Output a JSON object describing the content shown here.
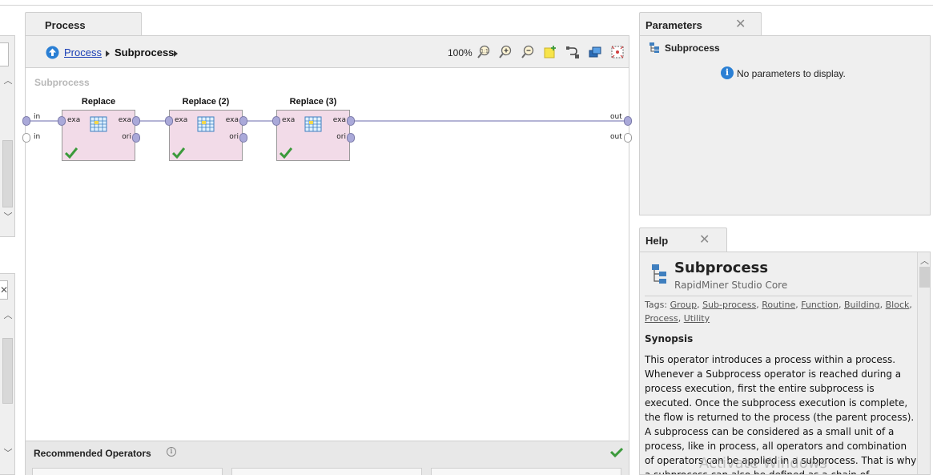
{
  "process_panel": {
    "tab_label": "Process",
    "breadcrumb": {
      "link": "Process",
      "current": "Subprocess"
    },
    "zoom": "100%",
    "canvas_title": "Subprocess",
    "left_ports": [
      "in",
      "in"
    ],
    "right_ports": [
      "out",
      "out"
    ],
    "operators": [
      {
        "name": "Replace",
        "in_label": "exa",
        "out_labels": [
          "exa",
          "ori"
        ]
      },
      {
        "name": "Replace (2)",
        "in_label": "exa",
        "out_labels": [
          "exa",
          "ori"
        ]
      },
      {
        "name": "Replace (3)",
        "in_label": "exa",
        "out_labels": [
          "exa",
          "ori"
        ]
      }
    ],
    "recommended_label": "Recommended Operators"
  },
  "parameters_panel": {
    "tab_label": "Parameters",
    "operator_name": "Subprocess",
    "message": "No parameters to display."
  },
  "help_panel": {
    "tab_label": "Help",
    "title": "Subprocess",
    "subtitle": "RapidMiner Studio Core",
    "tags_label": "Tags:",
    "tags": [
      "Group",
      "Sub-process",
      "Routine",
      "Function",
      "Building",
      "Block",
      "Process",
      "Utility"
    ],
    "synopsis_heading": "Synopsis",
    "synopsis_lines": [
      "This operator introduces a process within a process.",
      "Whenever a Subprocess operator is reached during a",
      "process execution, first the entire subprocess is",
      "executed. Once the subprocess execution is complete,",
      "the flow is returned to the process (the parent process).",
      "A subprocess can be considered as a small unit of a",
      "process, like in process, all operators and combination",
      "of operators can be applied in a subprocess. That is why",
      "a subprocess can also be defined as a chain of"
    ]
  },
  "watermark": "Activate Windows",
  "colors": {
    "accent": "#1a3fb5",
    "operator_fill": "#f2dbe8",
    "port": "#aaa9d9",
    "check": "#3b9a3b"
  }
}
